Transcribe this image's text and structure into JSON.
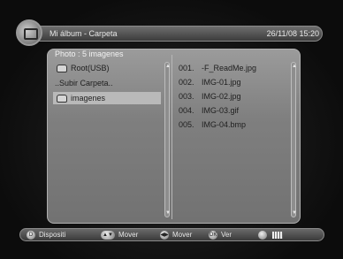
{
  "header": {
    "title": "Mi álbum - Carpeta",
    "clock": "26/11/08  15:20"
  },
  "photo": {
    "label": "Photo :   5 imagenes"
  },
  "folders": [
    {
      "label": "Root(USB)",
      "icon": "folder-icon"
    },
    {
      "label": "..Subir Carpeta..",
      "icon": ""
    },
    {
      "label": "imagenes",
      "icon": "folder-icon",
      "selected": true
    }
  ],
  "files": [
    {
      "num": "001.",
      "name": "-F_ReadMe.jpg"
    },
    {
      "num": "002.",
      "name": "IMG-01.jpg"
    },
    {
      "num": "003.",
      "name": "IMG-02.jpg"
    },
    {
      "num": "004.",
      "name": "IMG-03.gif"
    },
    {
      "num": "005.",
      "name": "IMG-04.bmp"
    }
  ],
  "footer": {
    "dispositivo": "Dispositi",
    "mover1": "Mover",
    "mover2": "Mover",
    "ver": "Ver",
    "btn_ok": "OK",
    "btn_dispositivo": "D"
  }
}
